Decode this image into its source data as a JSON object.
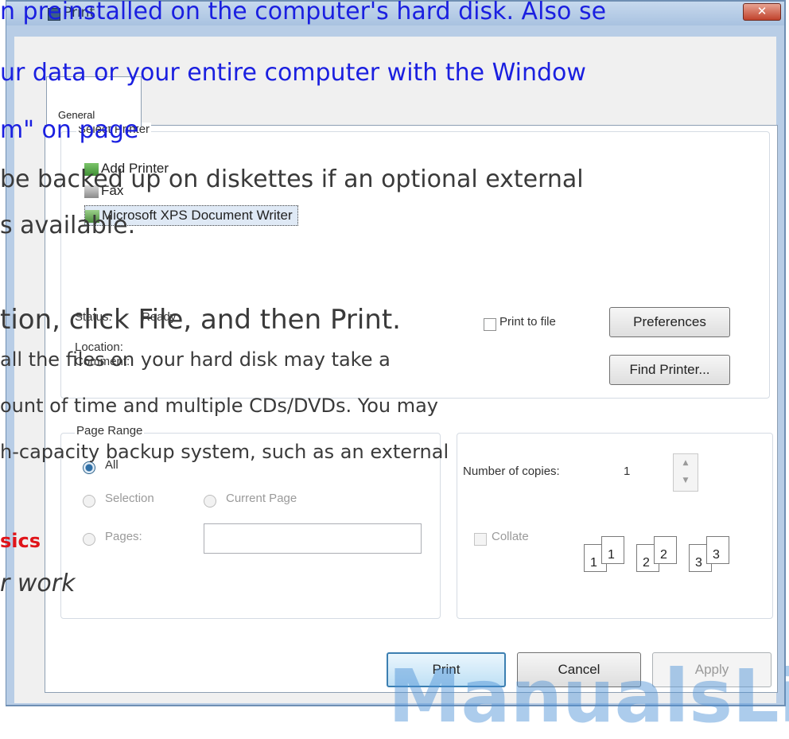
{
  "dialog": {
    "title": "Print",
    "close_glyph": "✕",
    "tab_general": "General",
    "select_printer_label": "Select Printer",
    "printers": [
      "Add Printer",
      "Fax",
      "Microsoft XPS Document Writer"
    ],
    "status_label": "Status:",
    "status_value": "Ready",
    "location_label": "Location:",
    "comment_label": "Comment:",
    "print_to_file_label": "Print to file",
    "preferences_button": "Preferences",
    "find_printer_button": "Find Printer...",
    "page_range_label": "Page Range",
    "range_all": "All",
    "range_selection": "Selection",
    "range_current_page": "Current Page",
    "range_pages": "Pages:",
    "pages_value": "",
    "copies_label": "Number of copies:",
    "copies_value": "1",
    "collate_label": "Collate",
    "collate_numbers": [
      "1",
      "1",
      "2",
      "2",
      "3",
      "3"
    ],
    "print_button": "Print",
    "cancel_button": "Cancel",
    "apply_button": "Apply"
  },
  "background_text": {
    "line1": "n preinstalled on the computer's hard disk. Also se",
    "line2": "ur data or your entire computer with the Window",
    "line3": "m\" on page",
    "line4": "be backed up on diskettes if an optional external",
    "line5": "s available.",
    "line6": "tion, click File, and then Print.",
    "line7": "all the files on your hard disk may take a",
    "line8": "ount of time and multiple CDs/DVDs. You may",
    "line9": "h-capacity backup system, such as an external",
    "heading": "sics",
    "italic": "r work"
  },
  "watermark": "ManualsLib.com",
  "colors": {
    "link_blue": "#1a1fe0",
    "heading_red": "#e0141a",
    "frame_blue": "#b8cde6"
  }
}
